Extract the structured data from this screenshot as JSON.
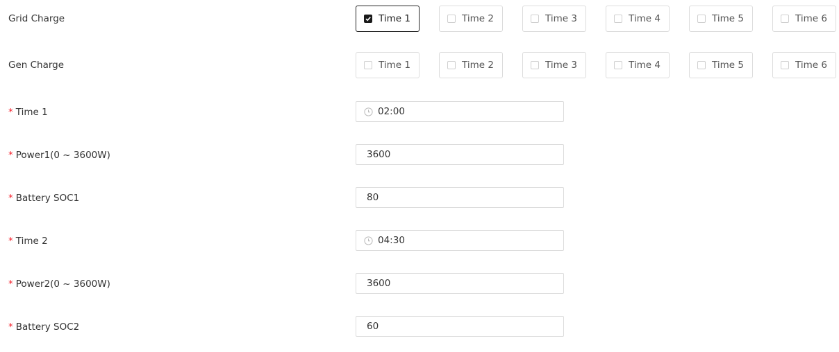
{
  "grid_charge": {
    "label": "Grid Charge",
    "options": [
      {
        "label": "Time 1",
        "checked": true
      },
      {
        "label": "Time 2",
        "checked": false
      },
      {
        "label": "Time 3",
        "checked": false
      },
      {
        "label": "Time 4",
        "checked": false
      },
      {
        "label": "Time 5",
        "checked": false
      },
      {
        "label": "Time 6",
        "checked": false
      }
    ]
  },
  "gen_charge": {
    "label": "Gen Charge",
    "options": [
      {
        "label": "Time 1",
        "checked": false
      },
      {
        "label": "Time 2",
        "checked": false
      },
      {
        "label": "Time 3",
        "checked": false
      },
      {
        "label": "Time 4",
        "checked": false
      },
      {
        "label": "Time 5",
        "checked": false
      },
      {
        "label": "Time 6",
        "checked": false
      }
    ]
  },
  "required_marker": "*",
  "fields": {
    "time1": {
      "label": "Time 1",
      "value": "02:00",
      "icon": "clock-icon"
    },
    "power1": {
      "label": "Power1(0 ~ 3600W)",
      "value": "3600"
    },
    "soc1": {
      "label": "Battery SOC1",
      "value": "80"
    },
    "time2": {
      "label": "Time 2",
      "value": "04:30",
      "icon": "clock-icon"
    },
    "power2": {
      "label": "Power2(0 ~ 3600W)",
      "value": "3600"
    },
    "soc2": {
      "label": "Battery SOC2",
      "value": "60"
    }
  },
  "colors": {
    "required": "#f5222d",
    "checked": "#1a1a1a",
    "border": "#dcdcdc"
  }
}
